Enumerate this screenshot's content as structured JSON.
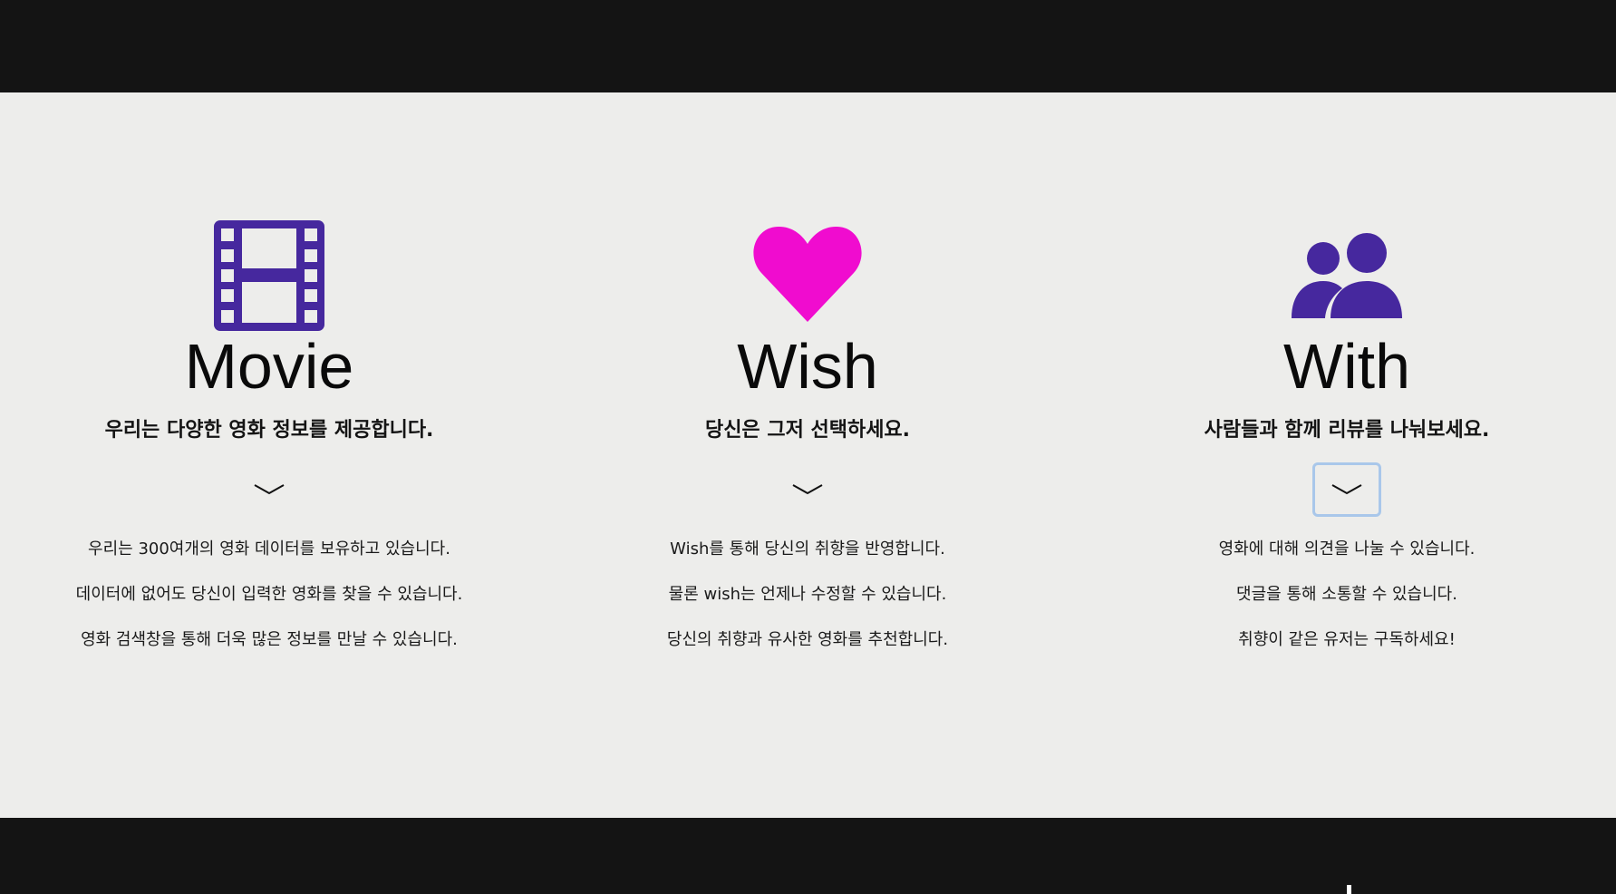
{
  "colors": {
    "header_bg": "#141414",
    "page_bg": "#ededeb",
    "icon_purple": "#46289e",
    "icon_pink": "#f00ccf",
    "focus_ring": "#a9c7ea"
  },
  "features": [
    {
      "icon": "film-icon",
      "title": "Movie",
      "subtitle": "우리는 다양한 영화 정보를 제공합니다.",
      "details": [
        "우리는 300여개의 영화 데이터를 보유하고 있습니다.",
        "데이터에 없어도 당신이 입력한 영화를 찾을 수 있습니다.",
        "영화 검색창을 통해 더욱 많은 정보를 만날 수 있습니다."
      ]
    },
    {
      "icon": "heart-icon",
      "title": "Wish",
      "subtitle": "당신은 그저 선택하세요.",
      "details": [
        "Wish를 통해 당신의 취향을 반영합니다.",
        "물론 wish는 언제나 수정할 수 있습니다.",
        "당신의 취향과 유사한 영화를 추천합니다."
      ]
    },
    {
      "icon": "users-icon",
      "title": "With",
      "subtitle": "사람들과 함께 리뷰를 나눠보세요.",
      "details": [
        "영화에 대해 의견을 나눌 수 있습니다.",
        "댓글을 통해 소통할 수 있습니다.",
        "취향이 같은 유저는 구독하세요!"
      ]
    }
  ]
}
